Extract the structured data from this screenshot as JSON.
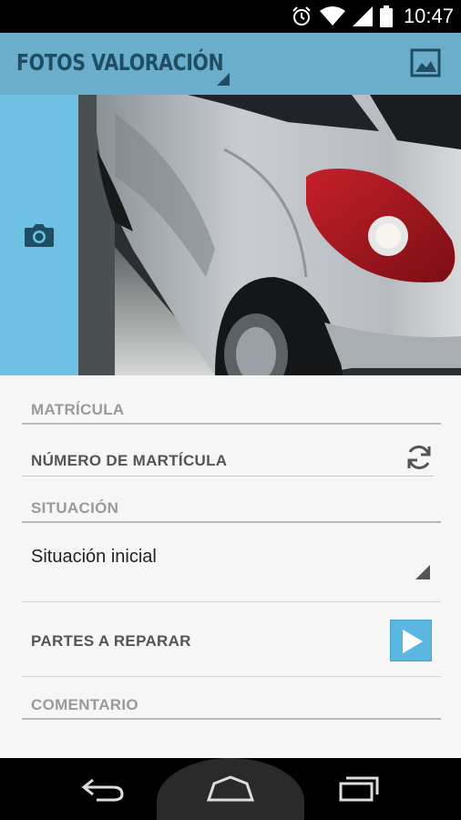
{
  "status_bar": {
    "time": "10:47",
    "icons": [
      "alarm-icon",
      "wifi-icon",
      "signal-icon",
      "battery-icon"
    ]
  },
  "action_bar": {
    "title": "FOTOS VALORACIÓN",
    "gallery_icon": "image-gallery-icon",
    "background_color": "#6aaecc"
  },
  "photo_panel": {
    "camera_icon": "camera-icon",
    "panel_color": "#6ec1e4"
  },
  "form": {
    "plate": {
      "header": "MATRÍCULA",
      "placeholder": "NÚMERO DE MARTÍCULA",
      "refresh_icon": "refresh-icon"
    },
    "situation": {
      "header": "SITUACIÓN",
      "selected": "Situación inicial"
    },
    "parts": {
      "label": "PARTES A REPARAR",
      "button_icon": "play-icon",
      "button_color": "#5ab7e1"
    },
    "comment": {
      "header": "COMENTARIO"
    }
  },
  "nav_bar": {
    "buttons": [
      "back-icon",
      "home-icon",
      "recent-apps-icon"
    ]
  }
}
